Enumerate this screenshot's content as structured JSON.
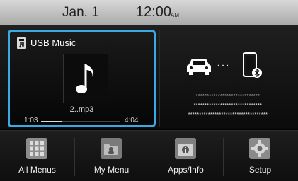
{
  "status_bar": {
    "date": "Jan.  1",
    "time": "12:00",
    "ampm": "AM"
  },
  "usb_widget": {
    "title": "USB Music",
    "file_name": "2..mp3",
    "elapsed": "1:03",
    "total": "4:04",
    "progress": 0.26,
    "icons": [
      "usb-icon",
      "music-note-icon"
    ]
  },
  "bt_widget": {
    "line1": "*****************************",
    "line2": "*******************************",
    "line3": "************************************",
    "icons": [
      "car-icon",
      "phone-icon",
      "bluetooth-icon"
    ]
  },
  "dock": [
    {
      "label": "All Menus",
      "icon": "grid-icon"
    },
    {
      "label": "My Menu",
      "icon": "folder-icon"
    },
    {
      "label": "Apps/Info",
      "icon": "apps-info-icon"
    },
    {
      "label": "Setup",
      "icon": "gear-icon"
    }
  ],
  "colors": {
    "accent": "#3aa9e6"
  }
}
